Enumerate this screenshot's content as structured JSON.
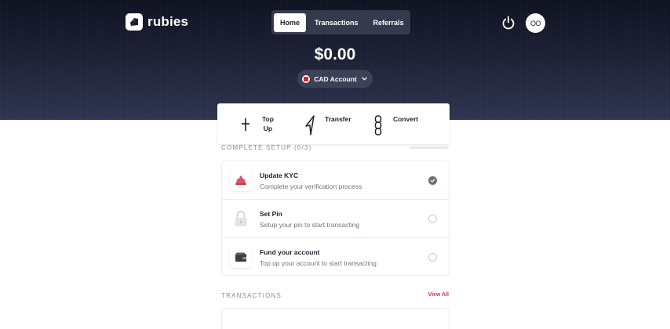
{
  "app": {
    "logo_text": "rubies",
    "logo_icon": "rubies-logo-mark"
  },
  "nav": {
    "tabs": [
      {
        "label": "Home",
        "active": true
      },
      {
        "label": "Transactions",
        "active": false
      },
      {
        "label": "Referrals",
        "active": false
      }
    ]
  },
  "header": {
    "power_icon": "power-icon",
    "avatar_initials": "OO"
  },
  "balance": {
    "amount": "$0.00",
    "account_label": "CAD Account",
    "flag_icon": "canada-flag-icon",
    "dropdown_icon": "chevron-down-icon"
  },
  "actions": [
    {
      "label_line1": "Top",
      "label_line2": "Up",
      "icon": "plus-icon"
    },
    {
      "label_line1": "Transfer",
      "label_line2": "",
      "icon": "send-arrow-icon"
    },
    {
      "label_line1": "Convert",
      "label_line2": "",
      "icon": "convert-chain-icon"
    }
  ],
  "setup": {
    "header": "COMPLETE SETUP (0/3)",
    "items": [
      {
        "title": "Update KYC",
        "description": "Complete your verification process",
        "icon": "kyc-bell-icon",
        "status": "done"
      },
      {
        "title": "Set Pin",
        "description": "Setup your pin to start transacting",
        "icon": "lock-icon",
        "status": "todo"
      },
      {
        "title": "Fund your account",
        "description": "Top up your account to start transacting",
        "icon": "wallet-icon",
        "status": "todo"
      }
    ]
  },
  "transactions": {
    "header": "TRANSACTIONS",
    "view_all": "View All"
  },
  "colors": {
    "hero_top": "#0f1220",
    "hero_bottom": "#2e3450",
    "accent": "#d6335a"
  }
}
